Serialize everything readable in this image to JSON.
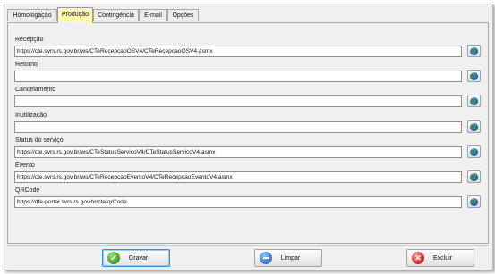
{
  "tabs": [
    {
      "label": "Homologação",
      "active": false
    },
    {
      "label": "Produção",
      "active": true
    },
    {
      "label": "Contingência",
      "active": false
    },
    {
      "label": "E-mail",
      "active": false
    },
    {
      "label": "Opções",
      "active": false
    }
  ],
  "fields": [
    {
      "label": "Recepção",
      "value": "https://cte.svrs.rs.gov.br/ws/CTeRecepcaoOSV4/CTeRecepcaoOSV4.asmx"
    },
    {
      "label": "Retorno",
      "value": ""
    },
    {
      "label": "Cancelamento",
      "value": ""
    },
    {
      "label": "Inutilização",
      "value": ""
    },
    {
      "label": "Status do serviço",
      "value": "https://cte.svrs.rs.gov.br/ws/CTeStatusServicoV4/CTeStatusServicoV4.asmx"
    },
    {
      "label": "Evento",
      "value": "https://cte.svrs.rs.gov.br/ws/CTeRecepcaoEventoV4/CTeRecepcaoEventoV4.asmx"
    },
    {
      "label": "QRCode",
      "value": "https://dfe-portal.svrs.rs.gov.br/cte/qrCode"
    }
  ],
  "buttons": {
    "save": "Gravar",
    "clear": "Limpar",
    "delete": "Excluir"
  },
  "icons": {
    "field_action": "globe-icon",
    "save": "checkmark-icon",
    "clear": "minus-icon",
    "delete": "x-icon"
  }
}
